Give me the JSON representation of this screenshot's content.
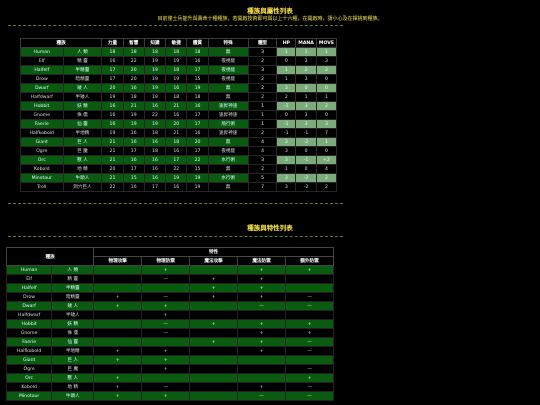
{
  "section1": {
    "title": "種族與屬性列表",
    "note": "目前僅士兵能升與壽命十種種族，若開啟技術即可與以上十六種，在開啟時，請小心及在揮挑到種族。",
    "headers": [
      "種族",
      "",
      "力量",
      "智慧",
      "知識",
      "敏捷",
      "體質",
      "特殊",
      "體型",
      "HP",
      "MANA",
      "MOVE"
    ],
    "rows": [
      {
        "en": "Human",
        "zh": "人 類",
        "str": "18",
        "int": "18",
        "wis": "18",
        "dex": "18",
        "con": "18",
        "special": "無",
        "size": "3",
        "hp": "1",
        "mana": "1",
        "move": "1",
        "green": true
      },
      {
        "en": "Elf",
        "zh": "精 靈",
        "str": "16",
        "int": "22",
        "wis": "19",
        "dex": "19",
        "con": "16",
        "special": "夜視能",
        "size": "2",
        "hp": "0",
        "mana": "3",
        "move": "3",
        "green": false
      },
      {
        "en": "Halfelf",
        "zh": "半精靈",
        "str": "17",
        "int": "20",
        "wis": "19",
        "dex": "18",
        "con": "17",
        "special": "夜視能",
        "size": "3",
        "hp": "1",
        "mana": "2",
        "move": "2",
        "green": true
      },
      {
        "en": "Drow",
        "zh": "暗精靈",
        "str": "17",
        "int": "20",
        "wis": "19",
        "dex": "19",
        "con": "15",
        "special": "夜視能",
        "size": "2",
        "hp": "1",
        "mana": "3",
        "move": "0",
        "green": false
      },
      {
        "en": "Dwarf",
        "zh": "矮 人",
        "str": "20",
        "int": "16",
        "wis": "19",
        "dex": "16",
        "con": "19",
        "special": "無",
        "size": "2",
        "hp": "3",
        "mana": "0",
        "move": "0",
        "green": true
      },
      {
        "en": "Halfdwarf",
        "zh": "半矮人",
        "str": "19",
        "int": "18",
        "wis": "18",
        "dex": "18",
        "con": "18",
        "special": "無",
        "size": "2",
        "hp": "2",
        "mana": "1",
        "move": "1",
        "green": false
      },
      {
        "en": "Hobbit",
        "zh": "妖 精",
        "str": "16",
        "int": "21",
        "wis": "16",
        "dex": "21",
        "con": "16",
        "special": "速昇神速",
        "size": "1",
        "hp": "-1",
        "mana": "3",
        "move": "2",
        "green": true
      },
      {
        "en": "Gnome",
        "zh": "侏 儒",
        "str": "16",
        "int": "19",
        "wis": "22",
        "dex": "16",
        "con": "17",
        "special": "速昇神速",
        "size": "1",
        "hp": "0",
        "mana": "3",
        "move": "0",
        "green": false
      },
      {
        "en": "Faerie",
        "zh": "仙 靈",
        "str": "16",
        "int": "19",
        "wis": "19",
        "dex": "20",
        "con": "17",
        "special": "飛行術",
        "size": "1",
        "hp": "-1",
        "mana": "3",
        "move": "3",
        "green": true
      },
      {
        "en": "Halfkobold",
        "zh": "半地精",
        "str": "19",
        "int": "16",
        "wis": "18",
        "dex": "21",
        "con": "16",
        "special": "速昇神速",
        "size": "2",
        "hp": "-1",
        "mana": "-1",
        "move": "7",
        "green": false
      },
      {
        "en": "Giant",
        "zh": "巨 人",
        "str": "21",
        "int": "16",
        "wis": "16",
        "dex": "18",
        "con": "20",
        "special": "無",
        "size": "4",
        "hp": "3",
        "mana": "-2",
        "move": "1",
        "green": true
      },
      {
        "en": "Ogre",
        "zh": "巨 魔",
        "str": "21",
        "int": "17",
        "wis": "18",
        "dex": "16",
        "con": "17",
        "special": "夜視能",
        "size": "4",
        "hp": "3",
        "mana": "0",
        "move": "0",
        "green": false
      },
      {
        "en": "Orc",
        "zh": "獸 人",
        "str": "21",
        "int": "16",
        "wis": "16",
        "dex": "17",
        "con": "22",
        "special": "水行術",
        "size": "3",
        "hp": "3",
        "mana": "-1",
        "move": "+2",
        "green": true
      },
      {
        "en": "Kobold",
        "zh": "地 精",
        "str": "20",
        "int": "17",
        "wis": "16",
        "dex": "22",
        "con": "15",
        "special": "無",
        "size": "2",
        "hp": "1",
        "mana": "0",
        "move": "4",
        "green": false
      },
      {
        "en": "Minotaur",
        "zh": "牛頭人",
        "str": "21",
        "int": "15",
        "wis": "16",
        "dex": "19",
        "con": "19",
        "special": "水行術",
        "size": "5",
        "hp": "3",
        "mana": "-2",
        "move": "2",
        "green": true
      },
      {
        "en": "Troll",
        "zh": "洞穴巨人",
        "str": "22",
        "int": "16",
        "wis": "17",
        "dex": "16",
        "con": "19",
        "special": "無",
        "size": "7",
        "hp": "3",
        "mana": "-2",
        "move": "2",
        "green": false
      }
    ]
  },
  "section2": {
    "title": "種族與特性列表",
    "header_race": "種族",
    "header_trait": "特性",
    "subheaders": [
      "物理攻擊",
      "物理防禦",
      "魔法攻擊",
      "魔法防禦",
      "額外防禦"
    ],
    "rows": [
      {
        "en": "Human",
        "zh": "人 類",
        "v": [
          "",
          "+",
          "",
          "+",
          "+"
        ],
        "green": true
      },
      {
        "en": "Elf",
        "zh": "精 靈",
        "v": [
          "",
          "—",
          "+",
          "+",
          ""
        ],
        "green": false
      },
      {
        "en": "Halfelf",
        "zh": "半精靈",
        "v": [
          "",
          "",
          "+",
          "+",
          ""
        ],
        "green": true
      },
      {
        "en": "Drow",
        "zh": "暗精靈",
        "v": [
          "+",
          "—",
          "+",
          "+",
          "—"
        ],
        "green": false
      },
      {
        "en": "Dwarf",
        "zh": "矮 人",
        "v": [
          "+",
          "+",
          "",
          "—",
          "—"
        ],
        "green": true
      },
      {
        "en": "Halfdwarf",
        "zh": "半矮人",
        "v": [
          "",
          "+",
          "",
          "",
          ""
        ],
        "green": false
      },
      {
        "en": "Hobbit",
        "zh": "妖 精",
        "v": [
          "",
          "—",
          "+",
          "+",
          "+"
        ],
        "green": true
      },
      {
        "en": "Gnome",
        "zh": "侏 儒",
        "v": [
          "",
          "—",
          "",
          "+",
          "+"
        ],
        "green": false
      },
      {
        "en": "Faerie",
        "zh": "仙 靈",
        "v": [
          "",
          "",
          "+",
          "+",
          "—"
        ],
        "green": true
      },
      {
        "en": "Halfkobold",
        "zh": "半地精",
        "v": [
          "+",
          "+",
          "",
          "+",
          "—"
        ],
        "green": false
      },
      {
        "en": "Giant",
        "zh": "巨 人",
        "v": [
          "+",
          "+",
          "",
          "",
          ""
        ],
        "green": true
      },
      {
        "en": "Ogre",
        "zh": "巨 魔",
        "v": [
          "",
          "+",
          "",
          "",
          "—"
        ],
        "green": false
      },
      {
        "en": "Orc",
        "zh": "獸 人",
        "v": [
          "+",
          "",
          "",
          "",
          "+"
        ],
        "green": true
      },
      {
        "en": "Kobold",
        "zh": "地 精",
        "v": [
          "+",
          "—",
          "",
          "+",
          "—"
        ],
        "green": false
      },
      {
        "en": "Minotaur",
        "zh": "牛頭人",
        "v": [
          "+",
          "+",
          "",
          "—",
          "—"
        ],
        "green": true
      }
    ]
  }
}
